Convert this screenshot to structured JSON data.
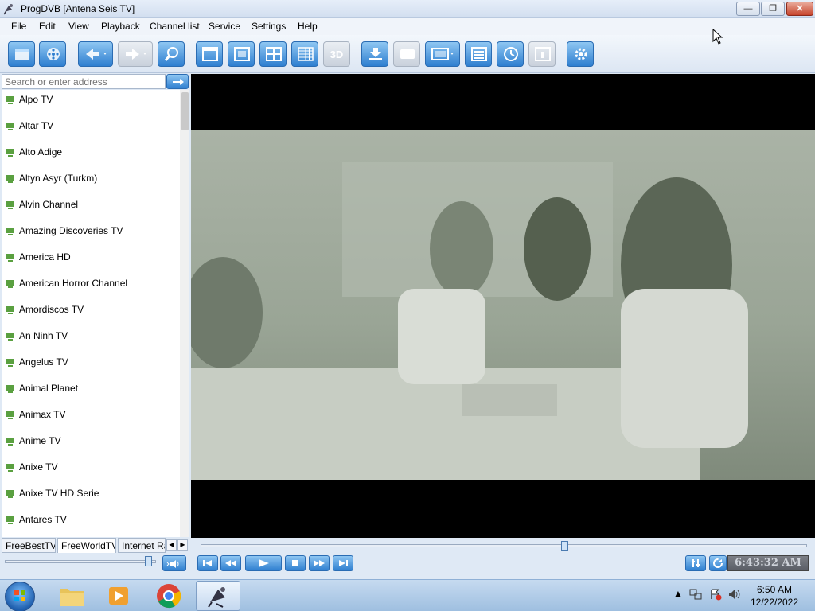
{
  "window": {
    "title": "ProgDVB [Antena Seis TV]",
    "min_label": "—",
    "max_label": "❐",
    "close_label": "✕"
  },
  "menu": [
    "File",
    "Edit",
    "View",
    "Playback",
    "Channel list",
    "Service",
    "Settings",
    "Help"
  ],
  "toolbar": {
    "button_3d_label": "3D"
  },
  "search": {
    "placeholder": "Search or enter address"
  },
  "channels": [
    "Alpo TV",
    "Altar TV",
    "Alto Adige",
    "Altyn Asyr (Turkm)",
    "Alvin Channel",
    "Amazing Discoveries TV",
    "America HD",
    "American Horror Channel",
    "Amordiscos TV",
    "An Ninh TV",
    "Angelus TV",
    "Animal Planet",
    "Animax TV",
    "Anime TV",
    "Anixe TV",
    "Anixe TV HD Serie",
    "Antares TV"
  ],
  "tabs": {
    "items": [
      "FreeBestTV",
      "FreeWorldTV",
      "Internet Rad"
    ],
    "active": "FreeWorldTV"
  },
  "volume": {
    "level": 0.97
  },
  "seek": {
    "position": 0.6
  },
  "playback": {
    "clock": "6:43:32 AM"
  },
  "taskbar": {
    "time": "6:50 AM",
    "date": "12/22/2022"
  },
  "colors": {
    "accent": "#2f7fd0",
    "tv_icon": "#5aa040",
    "close": "#c6432b"
  }
}
